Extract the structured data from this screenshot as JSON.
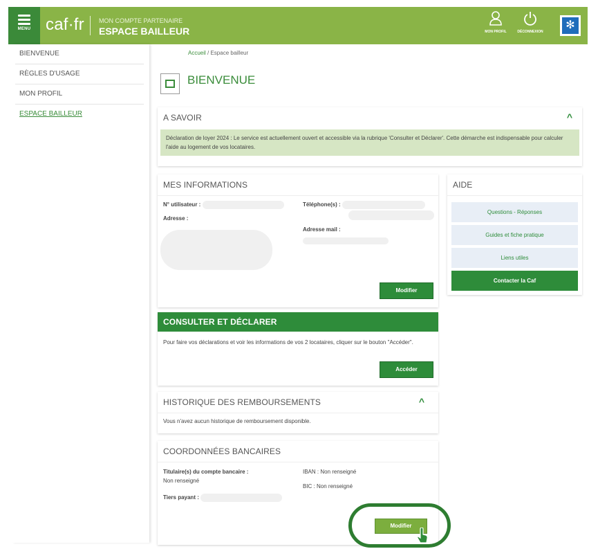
{
  "header": {
    "menu_label": "MENU",
    "logo": "caf·fr",
    "account_subtitle": "MON COMPTE PARTENAIRE",
    "account_title": "ESPACE BAILLEUR",
    "profile_label": "MON PROFIL",
    "logout_label": "DÉCONNEXION"
  },
  "sidebar": {
    "items": [
      {
        "label": "BIENVENUE"
      },
      {
        "label": "RÈGLES D'USAGE"
      },
      {
        "label": "MON PROFIL"
      },
      {
        "label": "ESPACE BAILLEUR"
      }
    ]
  },
  "breadcrumb": {
    "home": "Accueil",
    "sep": " / ",
    "current": "Espace bailleur"
  },
  "page": {
    "title": "BIENVENUE"
  },
  "a_savoir": {
    "title": "A SAVOIR",
    "message": "Déclaration de loyer 2024 : Le service est actuellement ouvert et accessible via la rubrique 'Consulter et Déclarer'. Cette démarche est indispensable pour calculer l'aide au logement de vos locataires."
  },
  "mes_informations": {
    "title": "MES INFORMATIONS",
    "user_number_label": "N° utilisateur :",
    "phone_label": "Téléphone(s) :",
    "address_label": "Adresse :",
    "email_label": "Adresse mail :",
    "modify_label": "Modifier"
  },
  "aide": {
    "title": "AIDE",
    "links": [
      {
        "label": "Questions - Réponses"
      },
      {
        "label": "Guides et fiche pratique"
      },
      {
        "label": "Liens utiles"
      },
      {
        "label": "Contacter la Caf"
      }
    ]
  },
  "consulter": {
    "title": "CONSULTER ET DÉCLARER",
    "text": "Pour faire vos déclarations et voir les informations de vos 2 locataires, cliquer sur le bouton \"Accéder\".",
    "access_label": "Accéder"
  },
  "historique": {
    "title": "HISTORIQUE DES REMBOURSEMENTS",
    "text": "Vous n'avez aucun historique de remboursement disponible."
  },
  "coordonnees": {
    "title": "COORDONNÉES BANCAIRES",
    "holder_label": "Titulaire(s) du compte bancaire :",
    "holder_value": "Non renseigné",
    "iban": "IBAN : Non renseigné",
    "bic": "BIC : Non renseigné",
    "tiers_label": "Tiers payant :",
    "modify_label": "Modifier"
  },
  "colors": {
    "brand_light": "#8ab447",
    "brand_dark": "#2e8c3a",
    "info_bg": "#d6e6c4"
  }
}
